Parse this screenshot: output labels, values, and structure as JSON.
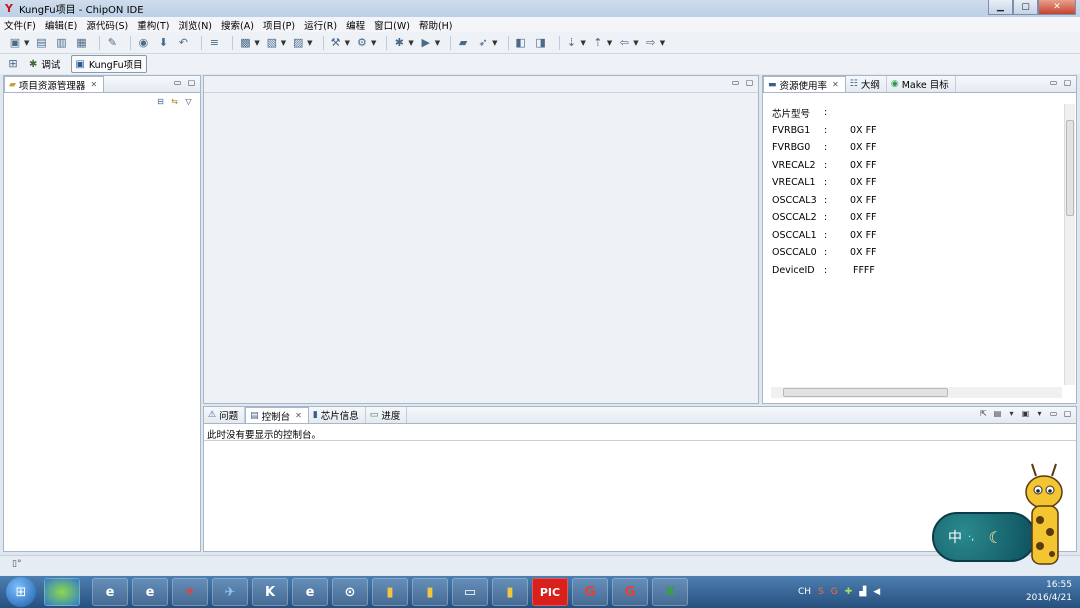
{
  "window": {
    "title": "KungFu项目 - ChipON IDE",
    "controls": {
      "minimize": "▁",
      "maximize": "▢",
      "close": "✕"
    }
  },
  "menu": [
    "文件(F)",
    "编辑(E)",
    "源代码(S)",
    "重构(T)",
    "浏览(N)",
    "搜索(A)",
    "项目(P)",
    "运行(R)",
    "编程",
    "窗口(W)",
    "帮助(H)"
  ],
  "perspectives": [
    {
      "label": "调试",
      "icon": "bug-icon",
      "active": false
    },
    {
      "label": "KungFu项目",
      "icon": "project-icon",
      "active": true
    }
  ],
  "left_panel": {
    "tab": "项目资源管理器"
  },
  "right_panel": {
    "tabs": [
      {
        "label": "资源使用率",
        "active": true
      },
      {
        "label": "大纲",
        "active": false
      },
      {
        "label": "Make 目标",
        "active": false
      }
    ],
    "rows": [
      {
        "name": "芯片型号",
        "colon": ":",
        "value": ""
      },
      {
        "name": "FVRBG1",
        "colon": ":",
        "value": "0X FF"
      },
      {
        "name": "FVRBG0",
        "colon": ":",
        "value": "0X FF"
      },
      {
        "name": "VRECAL2",
        "colon": ":",
        "value": "0X FF"
      },
      {
        "name": "VRECAL1",
        "colon": ":",
        "value": "0X FF"
      },
      {
        "name": "OSCCAL3",
        "colon": ":",
        "value": "0X FF"
      },
      {
        "name": "OSCCAL2",
        "colon": ":",
        "value": "0X FF"
      },
      {
        "name": "OSCCAL1",
        "colon": ":",
        "value": "0X FF"
      },
      {
        "name": "OSCCAL0",
        "colon": ":",
        "value": "0X FF"
      },
      {
        "name": "DeviceID",
        "colon": ":",
        "value": "FFFF"
      }
    ]
  },
  "bottom_panel": {
    "tabs": [
      {
        "label": "问题",
        "active": false
      },
      {
        "label": "控制台",
        "active": true
      },
      {
        "label": "芯片信息",
        "active": false
      },
      {
        "label": "进度",
        "active": false
      }
    ],
    "message": "此时没有要显示的控制台。"
  },
  "ime_widget": {
    "label": "中"
  },
  "taskbar": {
    "apps": [
      "e",
      "e",
      "✈",
      "✈",
      "K",
      "e",
      "⊙",
      "▮",
      "▮",
      "▭",
      "▮",
      "PIC",
      "G",
      "G",
      "X"
    ],
    "tray": {
      "lang": "CH"
    },
    "clock": {
      "time": "16:55",
      "date": "2016/4/21"
    }
  }
}
